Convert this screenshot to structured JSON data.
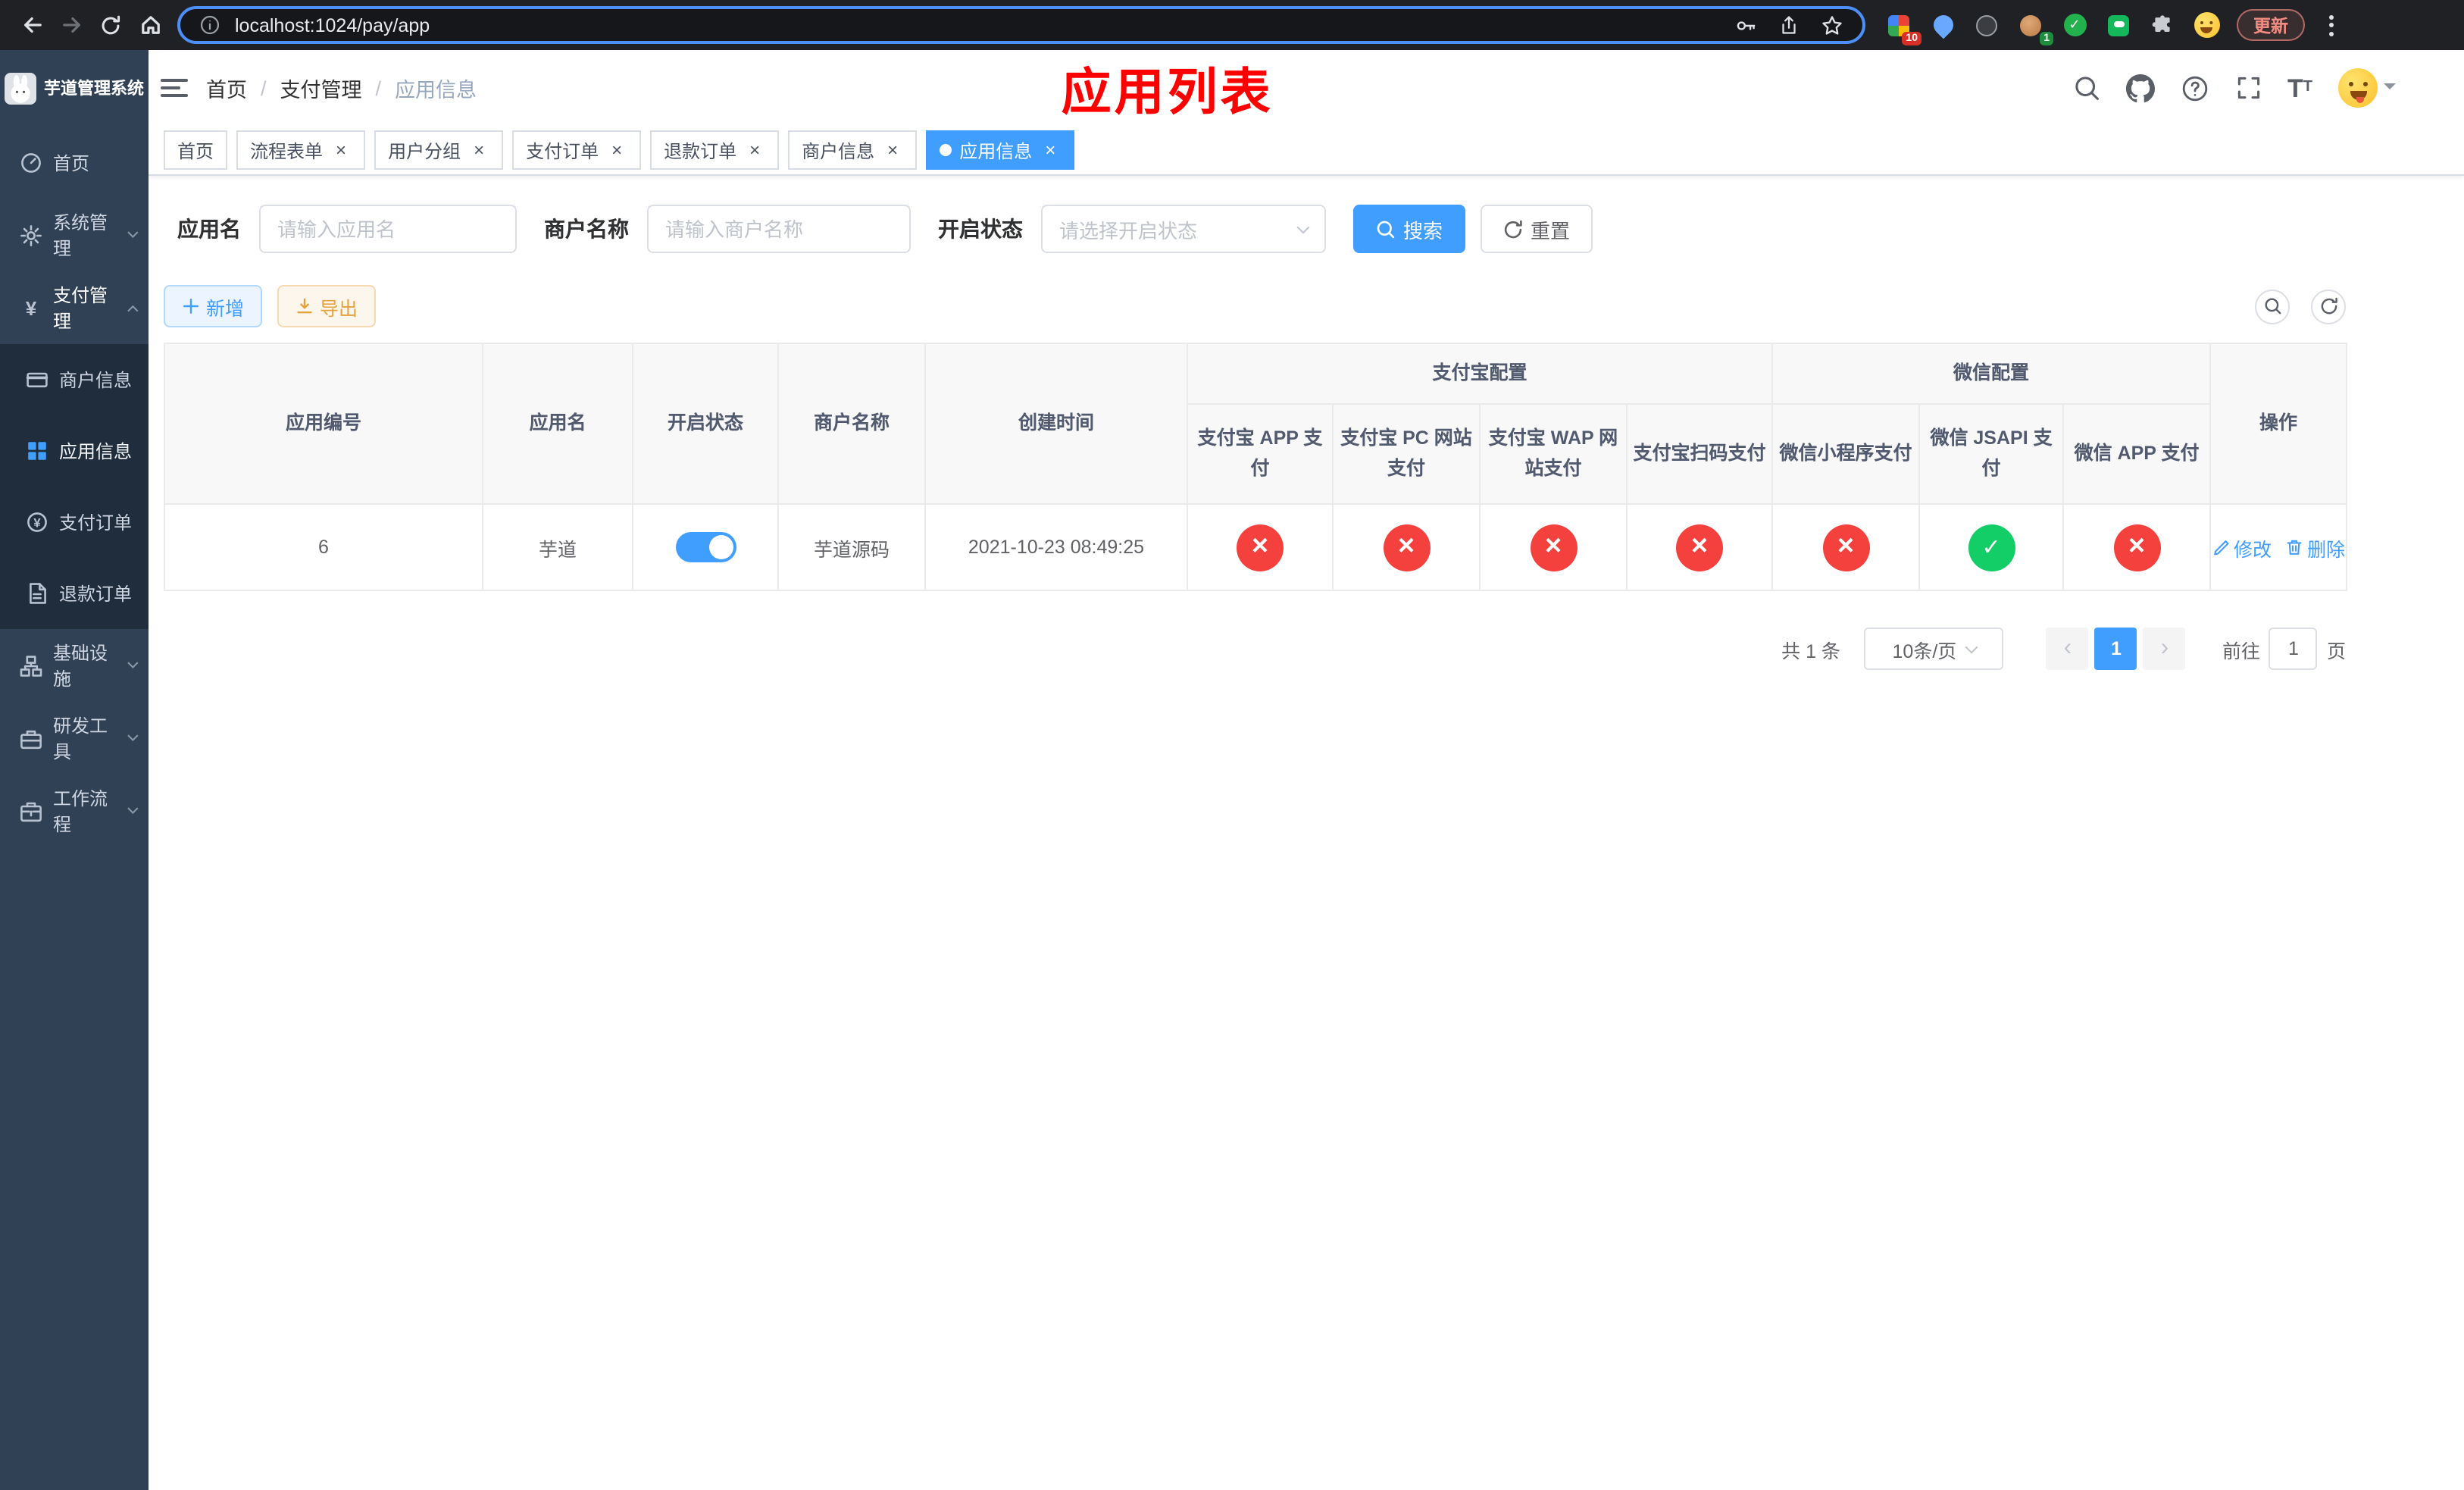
{
  "browser": {
    "url": "localhost:1024/pay/app",
    "update_label": "更新",
    "extension_badges": {
      "apps": "10",
      "profile": "1"
    }
  },
  "sidebar": {
    "app_title": "芋道管理系统",
    "items": [
      {
        "label": "首页"
      },
      {
        "label": "系统管理"
      },
      {
        "label": "支付管理",
        "children": [
          {
            "label": "商户信息"
          },
          {
            "label": "应用信息",
            "active": true
          },
          {
            "label": "支付订单"
          },
          {
            "label": "退款订单"
          }
        ]
      },
      {
        "label": "基础设施"
      },
      {
        "label": "研发工具"
      },
      {
        "label": "工作流程"
      }
    ]
  },
  "navbar": {
    "breadcrumb": [
      "首页",
      "支付管理",
      "应用信息"
    ],
    "page_title": "应用列表"
  },
  "tabs": [
    {
      "label": "首页",
      "closable": false,
      "active": false
    },
    {
      "label": "流程表单",
      "closable": true,
      "active": false
    },
    {
      "label": "用户分组",
      "closable": true,
      "active": false
    },
    {
      "label": "支付订单",
      "closable": true,
      "active": false
    },
    {
      "label": "退款订单",
      "closable": true,
      "active": false
    },
    {
      "label": "商户信息",
      "closable": true,
      "active": false
    },
    {
      "label": "应用信息",
      "closable": true,
      "active": true
    }
  ],
  "filters": {
    "app_name": {
      "label": "应用名",
      "placeholder": "请输入应用名",
      "value": ""
    },
    "merchant_name": {
      "label": "商户名称",
      "placeholder": "请输入商户名称",
      "value": ""
    },
    "status": {
      "label": "开启状态",
      "placeholder": "请选择开启状态",
      "value": ""
    },
    "search_label": "搜索",
    "reset_label": "重置"
  },
  "toolbar": {
    "add_label": "新增",
    "export_label": "导出"
  },
  "table": {
    "headers": {
      "app_id": "应用编号",
      "app_name": "应用名",
      "status": "开启状态",
      "merchant": "商户名称",
      "created": "创建时间",
      "alipay_group": "支付宝配置",
      "wechat_group": "微信配置",
      "alipay_app": "支付宝 APP 支付",
      "alipay_pc": "支付宝 PC 网站支付",
      "alipay_wap": "支付宝 WAP 网站支付",
      "alipay_qr": "支付宝扫码支付",
      "wx_lite": "微信小程序支付",
      "wx_jsapi": "微信 JSAPI 支付",
      "wx_app": "微信 APP 支付",
      "actions": "操作"
    },
    "row": {
      "app_id": "6",
      "app_name": "芋道",
      "enabled": "true",
      "merchant": "芋道源码",
      "created": "2021-10-23 08:49:25",
      "statuses": [
        "cross",
        "cross",
        "cross",
        "cross",
        "cross",
        "check",
        "cross"
      ],
      "edit_label": "修改",
      "delete_label": "删除"
    }
  },
  "pagination": {
    "total": "共 1 条",
    "page_size": "10条/页",
    "current_page": "1",
    "goto_label": "前往",
    "goto_value": "1",
    "unit_label": "页"
  },
  "icons": {
    "close": "×",
    "check": "✓",
    "cross": "×",
    "caret": "▾"
  },
  "colors": {
    "primary": "#409EFF",
    "success": "#13ce66",
    "danger": "#f5413d",
    "page_title_red": "#ff0000",
    "sidebar_bg": "#304156",
    "submenu_bg": "#1f2d3d"
  }
}
